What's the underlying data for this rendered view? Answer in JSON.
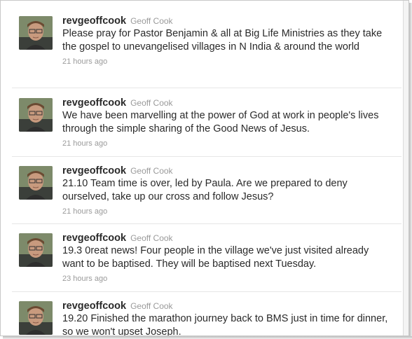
{
  "tweets": [
    {
      "screen_name": "revgeoffcook",
      "full_name": "Geoff Cook",
      "text": "Please pray for Pastor Benjamin & all at Big Life Ministries as they take the gospel to unevangelised villages in N India & around the world",
      "time": "21 hours ago",
      "avatar_icon": "user-photo"
    },
    {
      "screen_name": "revgeoffcook",
      "full_name": "Geoff Cook",
      "text": "We have been marvelling at the power of God at work in people's lives through the simple sharing of the Good News of Jesus.",
      "time": "21 hours ago",
      "avatar_icon": "user-photo"
    },
    {
      "screen_name": "revgeoffcook",
      "full_name": "Geoff Cook",
      "text": "21.10 Team time is over, led by Paula. Are we prepared to deny ourselved, take up our cross and follow Jesus?",
      "time": "21 hours ago",
      "avatar_icon": "user-photo"
    },
    {
      "screen_name": "revgeoffcook",
      "full_name": "Geoff Cook",
      "text": "19.3 0reat news! Four people in the village we've just visited already want to be baptised. They will be baptised next Tuesday.",
      "time": "23 hours ago",
      "avatar_icon": "user-photo"
    },
    {
      "screen_name": "revgeoffcook",
      "full_name": "Geoff Cook",
      "text": "19.20 Finished the marathon journey back to BMS just in time for dinner, so we won't upset Joseph.",
      "time": "",
      "avatar_icon": "user-photo"
    }
  ],
  "colors": {
    "text": "#2a2a2a",
    "muted": "#9a9a9a",
    "divider": "#e6e6e6"
  }
}
